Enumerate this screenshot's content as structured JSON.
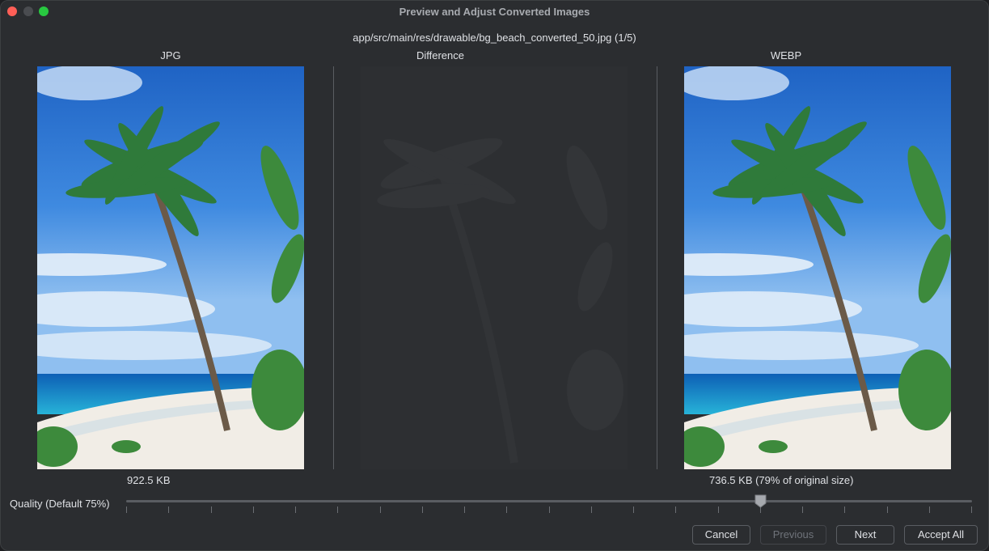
{
  "window": {
    "title": "Preview and Adjust Converted Images"
  },
  "file": {
    "path": "app/src/main/res/drawable/bg_beach_converted_50.jpg (1/5)"
  },
  "columns": {
    "left_label": "JPG",
    "middle_label": "Difference",
    "right_label": "WEBP"
  },
  "sizes": {
    "original": "922.5 KB",
    "converted": "736.5 KB (79% of original size)"
  },
  "quality": {
    "label": "Quality (Default 75%)",
    "value_fraction": 0.75
  },
  "buttons": {
    "cancel": "Cancel",
    "previous": "Previous",
    "next": "Next",
    "accept_all": "Accept All"
  },
  "colors": {
    "close": "#ff5f57",
    "maximize": "#28c840",
    "background": "#2b2d30",
    "sky": "#2f7bd6",
    "sea": "#0e7fc9"
  }
}
